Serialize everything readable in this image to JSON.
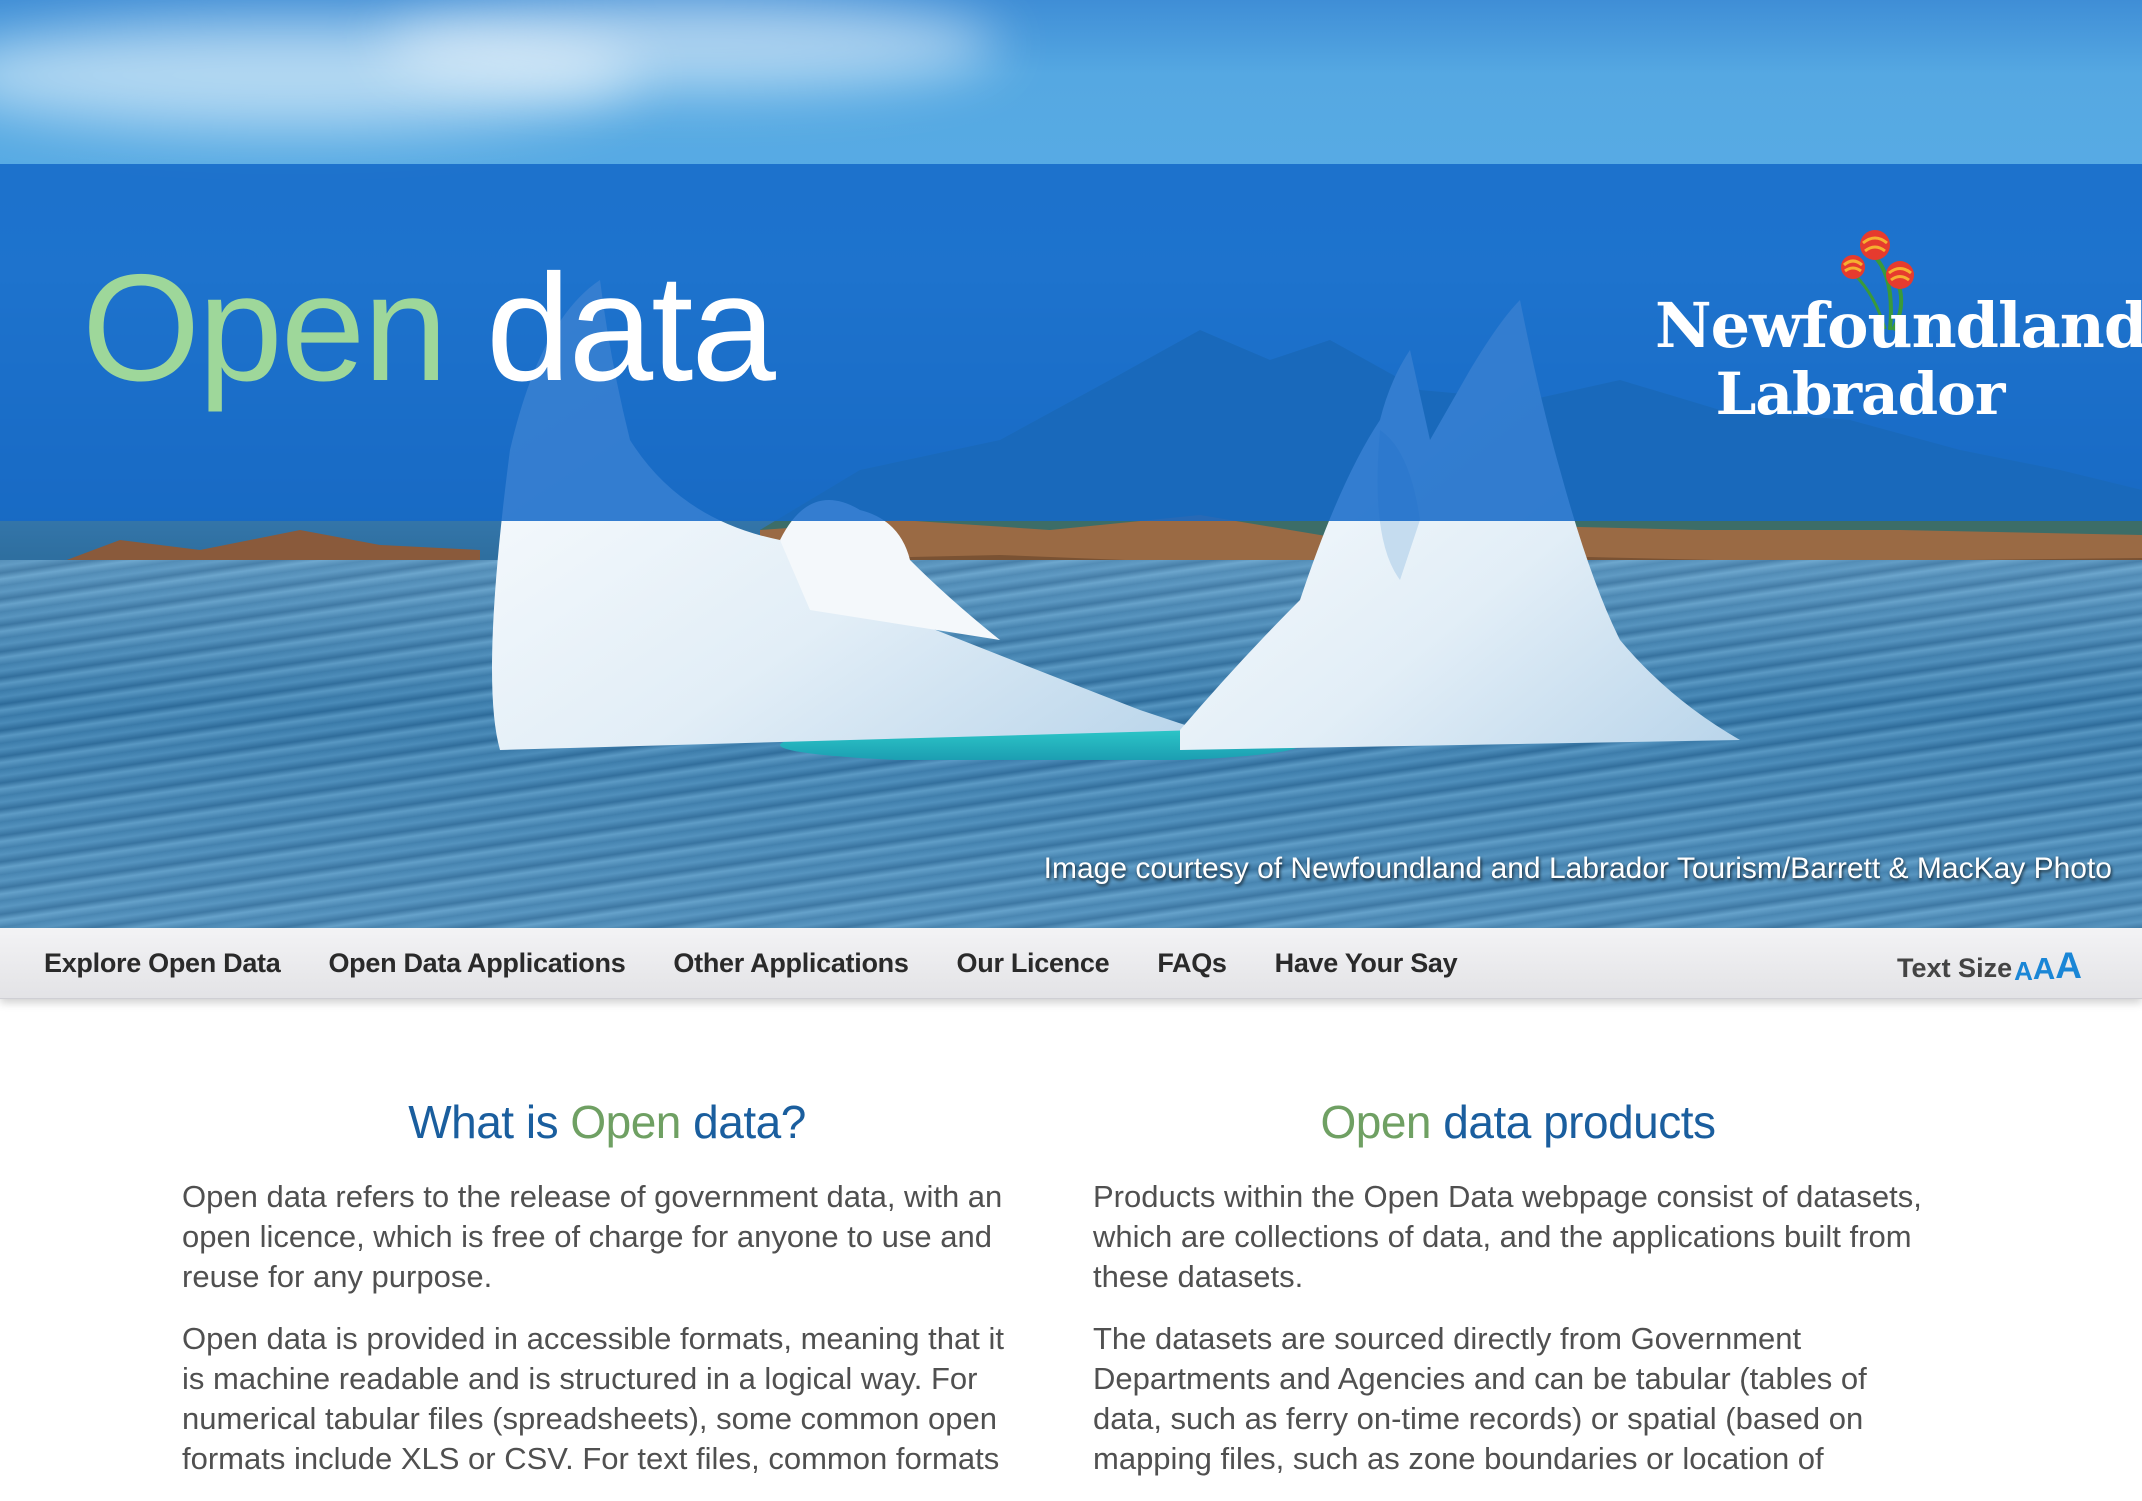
{
  "hero": {
    "title_open": "Open",
    "title_data": "data",
    "logo_line1": "Newfoundland",
    "logo_line2": "Labrador",
    "credit": "Image courtesy of Newfoundland and Labrador Tourism/Barrett & MacKay Photo"
  },
  "nav": {
    "items": [
      {
        "label": "Explore Open Data"
      },
      {
        "label": "Open Data Applications"
      },
      {
        "label": "Other Applications"
      },
      {
        "label": "Our Licence"
      },
      {
        "label": "FAQs"
      },
      {
        "label": "Have Your Say"
      }
    ],
    "text_size_label": "Text Size",
    "text_size_small": "A",
    "text_size_medium": "A",
    "text_size_large": "A"
  },
  "sections": {
    "left": {
      "heading_pre": "What is ",
      "heading_accent": "Open",
      "heading_post": " data?",
      "p1": "Open data refers to the release of government data, with an open licence, which is free of charge for anyone to use and reuse for any purpose.",
      "p2": "Open data is provided in accessible formats, meaning that it is machine readable and is structured in a logical way. For numerical tabular files (spreadsheets), some common open formats include XLS or CSV. For text files, common formats"
    },
    "right": {
      "heading_accent": "Open",
      "heading_post": " data products",
      "p1": "Products within the Open Data webpage consist of datasets, which are collections of data, and the applications built from these datasets.",
      "p2": "The datasets are sourced directly from Government Departments and Agencies and can be tabular (tables of data, such as ferry on-time records) or spatial (based on mapping files, such as zone boundaries or location of"
    }
  },
  "colors": {
    "band_blue": "#1469c8",
    "accent_green": "#9ed79a",
    "heading_blue": "#1a5e9e",
    "heading_green": "#6fa063",
    "text_size_blue": "#1a86d6"
  }
}
